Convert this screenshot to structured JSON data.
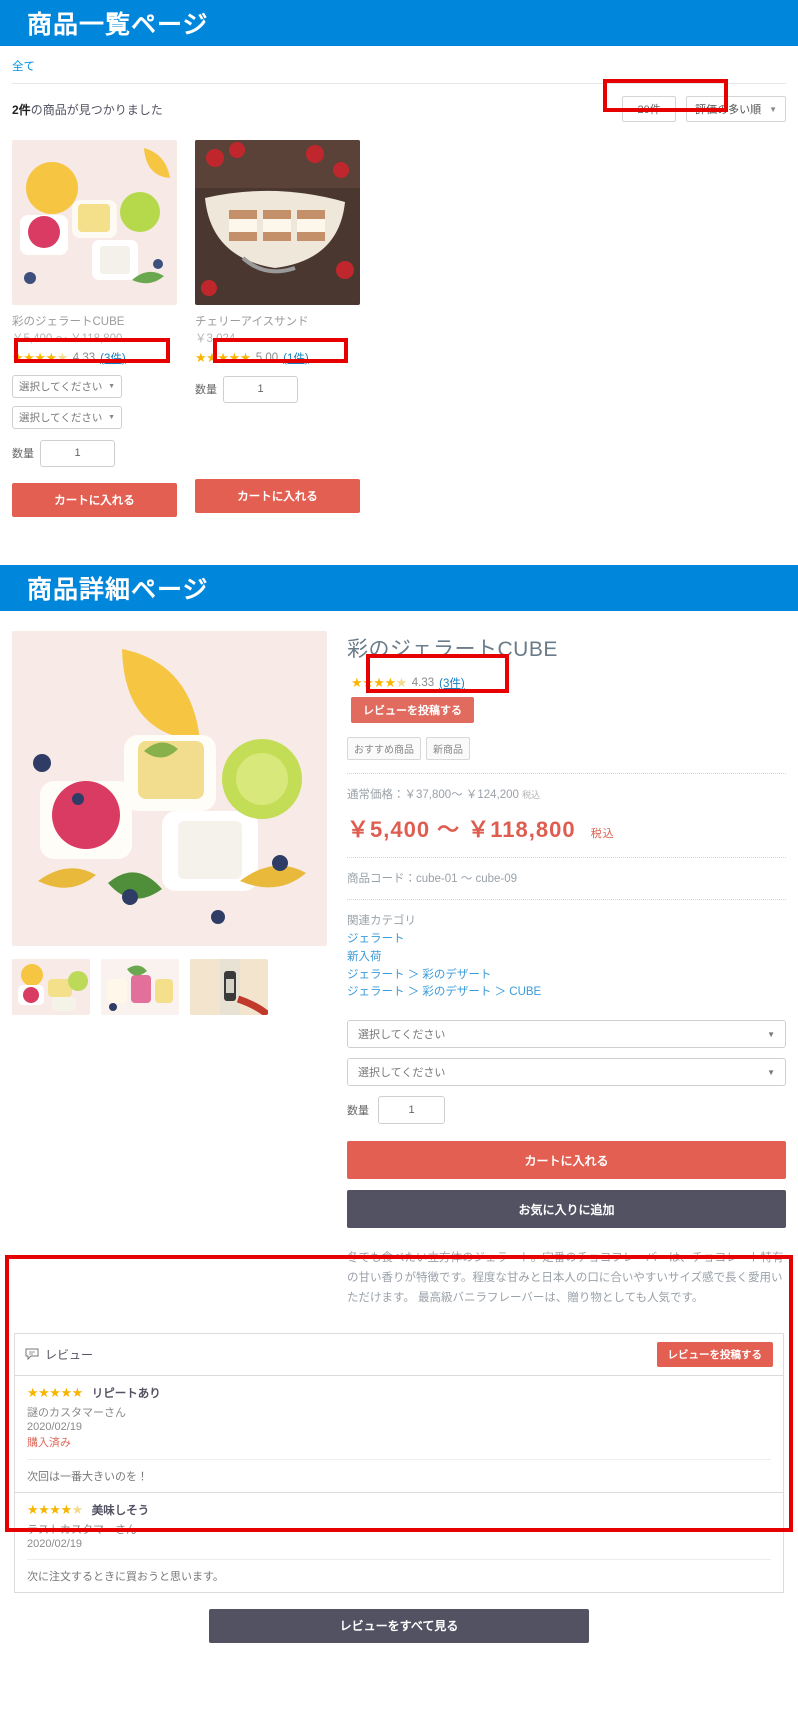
{
  "listing_section": {
    "banner_title": "商品一覧ページ",
    "breadcrumb": "全て",
    "result_text_count": "2件",
    "result_text_rest": "の商品が見つかりました",
    "per_page_label": "20件",
    "sort_label": "評価の多い順",
    "caret": "▼",
    "products": [
      {
        "name": "彩のジェラートCUBE",
        "price": "￥5,400 ～ ￥118,800",
        "stars": "★★★★",
        "half_star": "★",
        "rating": "4.33",
        "review_count": "(3件)",
        "select1": "選択してください",
        "select2": "選択してください",
        "qty_label": "数量",
        "qty_value": "1",
        "cart_label": "カートに入れる"
      },
      {
        "name": "チェリーアイスサンド",
        "price": "￥3,024",
        "stars": "★★★★★",
        "half_star": "",
        "rating": "5.00",
        "review_count": "(1件)",
        "qty_label": "数量",
        "qty_value": "1",
        "cart_label": "カートに入れる"
      }
    ]
  },
  "detail_section": {
    "banner_title": "商品詳細ページ",
    "title": "彩のジェラートCUBE",
    "stars": "★★★★",
    "half_star": "★",
    "rating": "4.33",
    "review_count": "(3件)",
    "post_review_label": "レビューを投稿する",
    "tags": [
      "おすすめ商品",
      "新商品"
    ],
    "normal_price_label": "通常価格：",
    "normal_price_value": "￥37,800～ ￥124,200",
    "normal_price_tax": "税込",
    "sale_price": "￥5,400 ～ ￥118,800",
    "sale_price_tax": "税込",
    "product_code_label": "商品コード：",
    "product_code_value": "cube-01 ～ cube-09",
    "category_heading": "関連カテゴリ",
    "categories": [
      "ジェラート",
      "新入荷",
      "ジェラート ＞ 彩のデザート",
      "ジェラート ＞ 彩のデザート ＞ CUBE"
    ],
    "select1": "選択してください",
    "select2": "選択してください",
    "caret": "▼",
    "qty_label": "数量",
    "qty_value": "1",
    "add_cart_label": "カートに入れる",
    "favorite_label": "お気に入りに追加",
    "description": "冬でも食べたい立方体のジェラート。定番のチョコフレーバーは、チョコレート特有の甘い香りが特徴です。程度な甘みと日本人の口に合いやすいサイズ感で長く愛用いただけます。\n最高級バニラフレーバーは、贈り物としても人気です。"
  },
  "review_section": {
    "header_title": "レビュー",
    "post_button_label": "レビューを投稿する",
    "items": [
      {
        "stars": "★★★★★",
        "empty_stars": "",
        "title": "リピートあり",
        "author": "謎のカスタマーさん",
        "date": "2020/02/19",
        "purchased": "購入済み",
        "body": "次回は一番大きいのを！"
      },
      {
        "stars": "★★★★",
        "empty_stars": "★",
        "title": "美味しそう",
        "author": "テストカスタマーさん",
        "date": "2020/02/19",
        "purchased": "",
        "body": "次に注文するときに買おうと思います。"
      }
    ],
    "see_all_label": "レビューをすべて見る"
  },
  "colors": {
    "banner_blue": "#0087dc",
    "cart_red": "#e35f52",
    "star_gold": "#f8b500",
    "anno_red": "#e60000",
    "dark_button": "#525263",
    "price_red": "#de5d50"
  }
}
